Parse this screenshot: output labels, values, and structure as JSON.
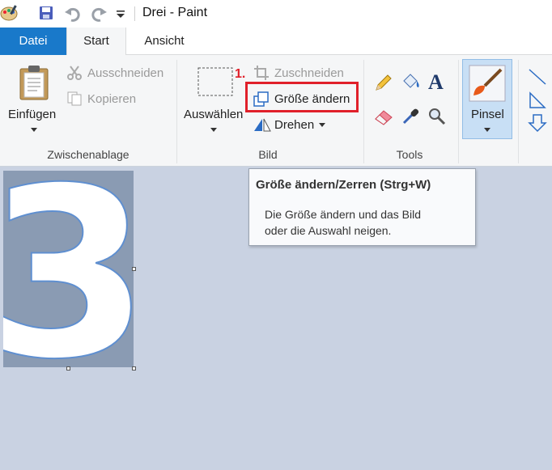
{
  "window": {
    "title": "Drei - Paint"
  },
  "quick_access": {
    "icons": [
      "paint-app-icon",
      "save-icon",
      "undo-icon",
      "redo-icon",
      "customize-qat-icon"
    ]
  },
  "tabs": [
    {
      "label": "Datei",
      "active": false
    },
    {
      "label": "Start",
      "active": true
    },
    {
      "label": "Ansicht",
      "active": false
    }
  ],
  "ribbon": {
    "clipboard": {
      "label": "Zwischenablage",
      "paste": "Einfügen",
      "cut": "Ausschneiden",
      "copy": "Kopieren"
    },
    "image": {
      "label": "Bild",
      "select": "Auswählen",
      "crop": "Zuschneiden",
      "resize": "Größe ändern",
      "rotate": "Drehen"
    },
    "tools": {
      "label": "Tools"
    },
    "brushes": {
      "label": "Pinsel"
    }
  },
  "annotation": {
    "step": "1."
  },
  "tooltip": {
    "title": "Größe ändern/Zerren (Strg+W)",
    "line1": "Die Größe ändern und das Bild",
    "line2": "oder die Auswahl neigen."
  },
  "canvas": {
    "glyph": "3"
  },
  "colors": {
    "accent": "#1979ca",
    "highlight": "#e0202a",
    "canvas": "#8a9bb3",
    "workspace": "#c9d2e2"
  }
}
